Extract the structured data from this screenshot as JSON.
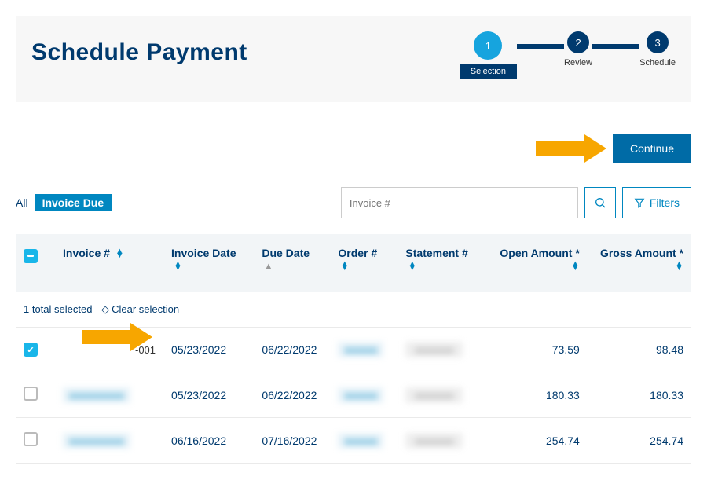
{
  "header": {
    "title": "Schedule Payment"
  },
  "stepper": [
    {
      "num": "1",
      "label": "Selection",
      "state": "active"
    },
    {
      "num": "2",
      "label": "Review",
      "state": "todo"
    },
    {
      "num": "3",
      "label": "Schedule",
      "state": "todo"
    }
  ],
  "actions": {
    "continue": "Continue"
  },
  "tabs": {
    "all": "All",
    "invoice_due": "Invoice Due"
  },
  "search": {
    "placeholder": "Invoice #"
  },
  "filters_btn": "Filters",
  "columns": {
    "invoice_no": "Invoice #",
    "invoice_date": "Invoice Date",
    "due_date": "Due Date",
    "order_no": "Order #",
    "statement_no": "Statement #",
    "open_amount": "Open Amount *",
    "gross_amount": "Gross Amount *"
  },
  "selection_bar": {
    "count_text": "1 total selected",
    "clear": "Clear selection"
  },
  "rows": [
    {
      "checked": true,
      "invoice_suffix": "-001",
      "invoice_date": "05/23/2022",
      "due_date": "06/22/2022",
      "open_amount": "73.59",
      "gross_amount": "98.48"
    },
    {
      "checked": false,
      "invoice_suffix": "",
      "invoice_date": "05/23/2022",
      "due_date": "06/22/2022",
      "open_amount": "180.33",
      "gross_amount": "180.33"
    },
    {
      "checked": false,
      "invoice_suffix": "",
      "invoice_date": "06/16/2022",
      "due_date": "07/16/2022",
      "open_amount": "254.74",
      "gross_amount": "254.74"
    }
  ]
}
